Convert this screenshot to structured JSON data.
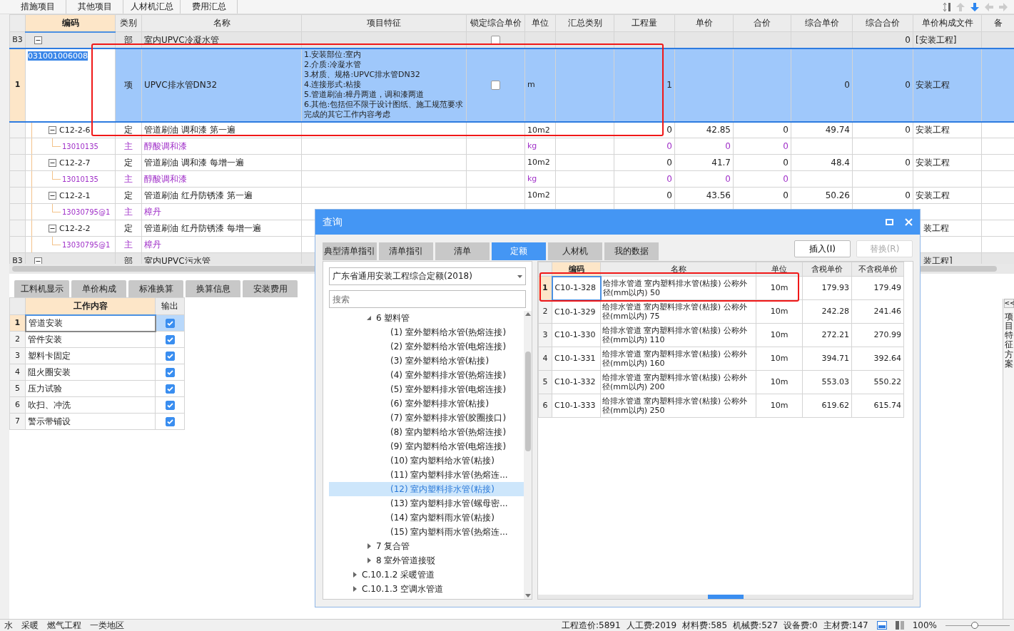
{
  "top_tabs": [
    {
      "label": "措施项目",
      "selected": false
    },
    {
      "label": "其他项目",
      "selected": false
    },
    {
      "label": "人材机汇总",
      "selected": false
    },
    {
      "label": "费用汇总",
      "selected": false
    }
  ],
  "main_table": {
    "columns": [
      {
        "label": "编码",
        "active": true
      },
      {
        "label": "类别",
        "active": false
      },
      {
        "label": "名称",
        "active": false
      },
      {
        "label": "项目特征",
        "active": false
      },
      {
        "label": "锁定综合单价",
        "active": false
      },
      {
        "label": "单位",
        "active": false
      },
      {
        "label": "汇总类别",
        "active": false
      },
      {
        "label": "工程量",
        "active": false
      },
      {
        "label": "单价",
        "active": false
      },
      {
        "label": "合价",
        "active": false
      },
      {
        "label": "综合单价",
        "active": false
      },
      {
        "label": "综合合价",
        "active": false
      },
      {
        "label": "单价构成文件",
        "active": false
      },
      {
        "label": "备",
        "active": false
      }
    ],
    "rows": [
      {
        "kind": "section",
        "selected": false,
        "row_header": "B3",
        "category": "部",
        "name": "室内UPVC冷凝水管",
        "locked": false,
        "composite_amount": "0",
        "price_file": "[安装工程]"
      },
      {
        "kind": "item",
        "selected": true,
        "outlined": true,
        "row_header": "1",
        "code": "031001006008",
        "category": "项",
        "name": "UPVC排水管DN32",
        "features": "1.安装部位:室内\n2.介质:冷凝水管\n3.材质、规格:UPVC排水管DN32\n4.连接形式:粘接\n5.管道刷油:樟丹两道，调和漆两道\n6.其他:包括但不限于设计图纸、施工规范要求完成的其它工作内容考虑",
        "locked": false,
        "unit": "m",
        "quantity": "1",
        "composite_price": "0",
        "composite_amount": "0",
        "price_file": "安装工程"
      },
      {
        "kind": "quota",
        "selected": false,
        "code": "C12-2-6",
        "category": "定",
        "name": "管道刷油 调和漆 第一遍",
        "unit": "10m2",
        "quantity": "0",
        "unit_price": "42.85",
        "amount": "0",
        "composite_price": "49.74",
        "composite_amount": "0",
        "price_file": "安装工程"
      },
      {
        "kind": "material",
        "selected": false,
        "code": "13010135",
        "category": "主",
        "name": "醇酸调和漆",
        "unit": "kg",
        "quantity": "0",
        "unit_price": "0",
        "amount": "0"
      },
      {
        "kind": "quota",
        "selected": false,
        "code": "C12-2-7",
        "category": "定",
        "name": "管道刷油 调和漆 每增一遍",
        "unit": "10m2",
        "quantity": "0",
        "unit_price": "41.7",
        "amount": "0",
        "composite_price": "48.4",
        "composite_amount": "0",
        "price_file": "安装工程"
      },
      {
        "kind": "material",
        "selected": false,
        "code": "13010135",
        "category": "主",
        "name": "醇酸调和漆",
        "unit": "kg",
        "quantity": "0",
        "unit_price": "0",
        "amount": "0"
      },
      {
        "kind": "quota",
        "selected": false,
        "code": "C12-2-1",
        "category": "定",
        "name": "管道刷油 红丹防锈漆 第一遍",
        "unit": "10m2",
        "quantity": "0",
        "unit_price": "43.56",
        "amount": "0",
        "composite_price": "50.26",
        "composite_amount": "0",
        "price_file": "安装工程"
      },
      {
        "kind": "material",
        "selected": false,
        "code": "13030795@1",
        "category": "主",
        "name": "樟丹"
      },
      {
        "kind": "quota",
        "selected": false,
        "code": "C12-2-2",
        "category": "定",
        "name": "管道刷油 红丹防锈漆 每增一遍",
        "price_file": "装工程",
        "cut": true
      },
      {
        "kind": "material",
        "selected": false,
        "code": "13030795@1",
        "category": "主",
        "name": "樟丹"
      },
      {
        "kind": "section",
        "selected": false,
        "row_header": "B3",
        "category": "部",
        "name": "室内UPVC污水管",
        "price_file": "装工程]",
        "cut": true
      }
    ]
  },
  "detail_tabs": [
    {
      "label": "工料机显示",
      "selected": false
    },
    {
      "label": "单价构成",
      "selected": false
    },
    {
      "label": "标准换算",
      "selected": false
    },
    {
      "label": "换算信息",
      "selected": false
    },
    {
      "label": "安装费用",
      "selected": false
    }
  ],
  "work_content": {
    "columns": [
      "工作内容",
      "输出"
    ],
    "rows": [
      {
        "number": "1",
        "label": "管道安装",
        "output": true,
        "selected": true
      },
      {
        "number": "2",
        "label": "管件安装",
        "output": true,
        "selected": false
      },
      {
        "number": "3",
        "label": "塑料卡固定",
        "output": true,
        "selected": false
      },
      {
        "number": "4",
        "label": "阻火圈安装",
        "output": true,
        "selected": false
      },
      {
        "number": "5",
        "label": "压力试验",
        "output": true,
        "selected": false
      },
      {
        "number": "6",
        "label": "吹扫、冲洗",
        "output": true,
        "selected": false
      },
      {
        "number": "7",
        "label": "警示带铺设",
        "output": true,
        "selected": false
      }
    ]
  },
  "side_panel": {
    "toggle": "<<",
    "label": "项目特征方案"
  },
  "dialog": {
    "title": "查询",
    "tabs": [
      {
        "label": "典型清单指引",
        "selected": false
      },
      {
        "label": "清单指引",
        "selected": false
      },
      {
        "label": "清单",
        "selected": false
      },
      {
        "label": "定额",
        "selected": true
      },
      {
        "label": "人材机",
        "selected": false
      },
      {
        "label": "我的数据",
        "selected": false
      }
    ],
    "buttons": [
      {
        "label": "插入(I)",
        "disabled": false
      },
      {
        "label": "替换(R)",
        "disabled": true
      }
    ],
    "library": "广东省通用安装工程综合定额(2018)",
    "search": {
      "placeholder": "搜索"
    },
    "tree": [
      {
        "children": [
          {
            "label": "6 塑料管",
            "expanded": true,
            "children": [
              {
                "label": "(1) 室外塑料给水管(热熔连接)",
                "selected": false
              },
              {
                "label": "(2) 室外塑料给水管(电熔连接)",
                "selected": false
              },
              {
                "label": "(3) 室外塑料给水管(粘接)",
                "selected": false
              },
              {
                "label": "(4) 室外塑料排水管(热熔连接)",
                "selected": false
              },
              {
                "label": "(5) 室外塑料排水管(电熔连接)",
                "selected": false
              },
              {
                "label": "(6) 室外塑料排水管(粘接)",
                "selected": false
              },
              {
                "label": "(7) 室外塑料排水管(胶圈接口)",
                "selected": false
              },
              {
                "label": "(8) 室内塑料给水管(热熔连接)",
                "selected": false
              },
              {
                "label": "(9) 室内塑料给水管(电熔连接)",
                "selected": false
              },
              {
                "label": "(10) 室内塑料给水管(粘接)",
                "selected": false
              },
              {
                "label": "(11) 室内塑料排水管(热熔连...",
                "selected": false
              },
              {
                "label": "(12) 室内塑料排水管(粘接)",
                "selected": true
              },
              {
                "label": "(13) 室内塑料排水管(螺母密...",
                "selected": false
              },
              {
                "label": "(14) 室内塑料雨水管(粘接)",
                "selected": false
              },
              {
                "label": "(15) 室内塑料雨水管(热熔连...",
                "selected": false
              }
            ]
          },
          {
            "label": "7 复合管",
            "expanded": false
          },
          {
            "label": "8 室外管道接驳",
            "expanded": false
          }
        ]
      },
      {
        "label": "C.10.1.2 采暖管道",
        "expanded": false
      },
      {
        "label": "C.10.1.3 空调水管道",
        "expanded": false
      }
    ],
    "results": {
      "columns": [
        "编码",
        "名称",
        "单位",
        "含税单价",
        "不含税单价"
      ],
      "rows": [
        {
          "number": "1",
          "code": "C10-1-328",
          "name": "给排水管道 室内塑料排水管(粘接) 公称外径(mm以内) 50",
          "unit": "10m",
          "price_tax": "179.93",
          "price_net": "179.49",
          "selected": true,
          "outlined": true
        },
        {
          "number": "2",
          "code": "C10-1-329",
          "name": "给排水管道 室内塑料排水管(粘接) 公称外径(mm以内) 75",
          "unit": "10m",
          "price_tax": "242.28",
          "price_net": "241.46",
          "selected": false
        },
        {
          "number": "3",
          "code": "C10-1-330",
          "name": "给排水管道 室内塑料排水管(粘接) 公称外径(mm以内) 110",
          "unit": "10m",
          "price_tax": "272.21",
          "price_net": "270.99",
          "selected": false
        },
        {
          "number": "4",
          "code": "C10-1-331",
          "name": "给排水管道 室内塑料排水管(粘接) 公称外径(mm以内) 160",
          "unit": "10m",
          "price_tax": "394.71",
          "price_net": "392.64",
          "selected": false
        },
        {
          "number": "5",
          "code": "C10-1-332",
          "name": "给排水管道 室内塑料排水管(粘接) 公称外径(mm以内) 200",
          "unit": "10m",
          "price_tax": "553.03",
          "price_net": "550.22",
          "selected": false
        },
        {
          "number": "6",
          "code": "C10-1-333",
          "name": "给排水管道 室内塑料排水管(粘接) 公称外径(mm以内) 250",
          "unit": "10m",
          "price_tax": "619.62",
          "price_net": "615.74",
          "selected": false
        }
      ]
    }
  },
  "status_bar": {
    "left": [
      "水",
      "采暖",
      "燃气工程",
      "一类地区"
    ],
    "summary": [
      "工程造价:5891",
      "人工费:2019",
      "材料费:585",
      "机械费:527",
      "设备费:0",
      "主材费:147"
    ],
    "zoom": "100%",
    "zoom_slider": {
      "level": 0.45
    }
  }
}
